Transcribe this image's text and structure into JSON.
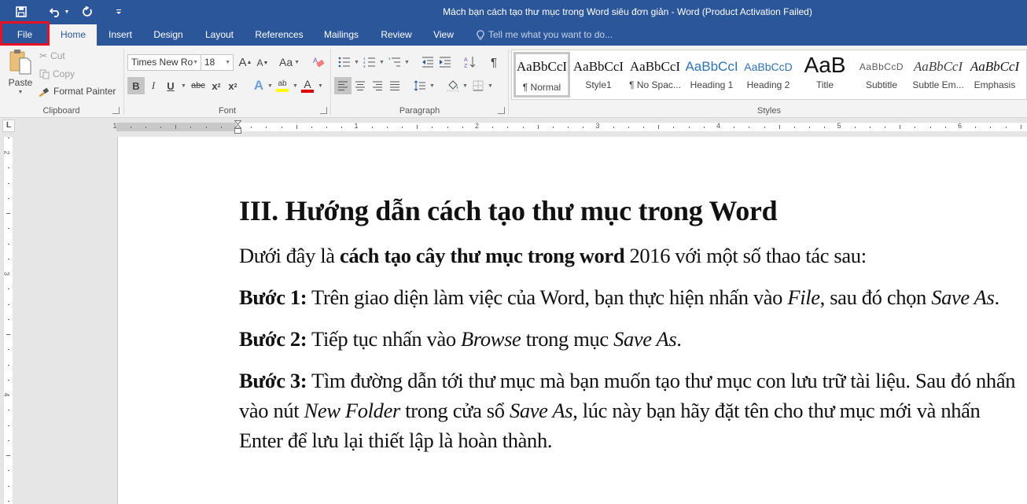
{
  "window": {
    "title": "Mách bạn cách tạo thư mục trong Word siêu đơn giản - Word (Product Activation Failed)"
  },
  "qat": {
    "save": "save-icon",
    "undo": "undo-icon",
    "redo": "redo-icon",
    "customize": "customize-qat-icon"
  },
  "tabs": [
    {
      "label": "File"
    },
    {
      "label": "Home"
    },
    {
      "label": "Insert"
    },
    {
      "label": "Design"
    },
    {
      "label": "Layout"
    },
    {
      "label": "References"
    },
    {
      "label": "Mailings"
    },
    {
      "label": "Review"
    },
    {
      "label": "View"
    }
  ],
  "tell_me": {
    "placeholder": "Tell me what you want to do..."
  },
  "ribbon": {
    "clipboard": {
      "label": "Clipboard",
      "paste": "Paste",
      "cut": "Cut",
      "copy": "Copy",
      "format_painter": "Format Painter"
    },
    "font": {
      "label": "Font",
      "font_name": "Times New Ro",
      "font_size": "18",
      "grow": "A",
      "shrink": "A",
      "change_case": "Aa",
      "bold": "B",
      "italic": "I",
      "underline": "U",
      "strikethrough": "abc",
      "subscript": "x",
      "superscript": "x",
      "text_effects": "A",
      "highlight": "ab",
      "font_color": "A",
      "highlight_color": "#ffff00",
      "font_color_value": "#e00000"
    },
    "paragraph": {
      "label": "Paragraph",
      "show_marks": "¶"
    },
    "styles": {
      "label": "Styles",
      "items": [
        {
          "preview": "AaBbCcI",
          "name": "¶ Normal",
          "selected": true
        },
        {
          "preview": "AaBbCcI",
          "name": "Style1"
        },
        {
          "preview": "AaBbCcI",
          "name": "¶ No Spac..."
        },
        {
          "preview": "AaBbCcI",
          "name": "Heading 1"
        },
        {
          "preview": "AaBbCcD",
          "name": "Heading 2"
        },
        {
          "preview": "AaB",
          "name": "Title"
        },
        {
          "preview": "AaBbCcD",
          "name": "Subtitle"
        },
        {
          "preview": "AaBbCcI",
          "name": "Subtle Em..."
        },
        {
          "preview": "AaBbCcI",
          "name": "Emphasis"
        }
      ]
    }
  },
  "ruler": {
    "horizontal_labels": [
      "1",
      "1",
      "2",
      "3",
      "4",
      "5",
      "6"
    ],
    "vertical_labels": [
      "2",
      "3",
      "4"
    ]
  },
  "document": {
    "heading": "III. Hướng dẫn cách tạo thư mục trong Word",
    "intro": {
      "pre": "Dưới đây là ",
      "bold": "cách tạo cây thư mục trong word",
      "post": " 2016 với một số thao tác sau:"
    },
    "step1": {
      "label": "Bước 1:",
      "t1": " Trên giao diện làm việc của Word, bạn thực hiện nhấn vào ",
      "i1": "File",
      "t2": ", sau đó chọn ",
      "i2": "Save As",
      "t3": "."
    },
    "step2": {
      "label": "Bước 2:",
      "t1": " Tiếp tục nhấn vào ",
      "i1": "Browse",
      "t2": " trong mục ",
      "i2": "Save As",
      "t3": "."
    },
    "step3": {
      "label": "Bước 3:",
      "t1": " Tìm đường dẫn tới thư mục mà bạn muốn tạo thư mục con lưu trữ tài liệu. Sau đó nhấn vào nút ",
      "i1": "New Folder",
      "t2": " trong cửa sổ ",
      "i2": "Save As",
      "t3": ", lúc này bạn hãy đặt tên cho thư mục mới và nhấn Enter để lưu lại thiết lập là hoàn thành."
    }
  },
  "colors": {
    "brand": "#2b579a",
    "highlight_box": "#e81123"
  }
}
